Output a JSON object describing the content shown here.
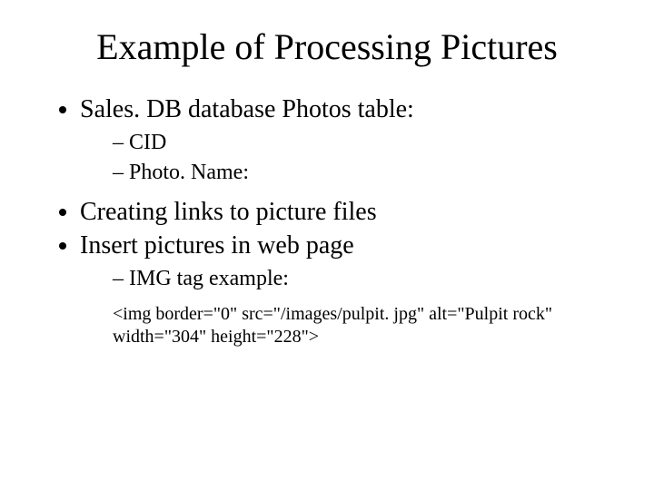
{
  "title": "Example of Processing Pictures",
  "bullets": {
    "b1": "Sales. DB database Photos table:",
    "b1_sub1": "CID",
    "b1_sub2": "Photo. Name:",
    "b2": "Creating links to picture files",
    "b3": "Insert pictures in web page",
    "b3_sub1": "IMG tag example:"
  },
  "code_example": "<img border=\"0\" src=\"/images/pulpit. jpg\" alt=\"Pulpit rock\" width=\"304\" height=\"228\">"
}
